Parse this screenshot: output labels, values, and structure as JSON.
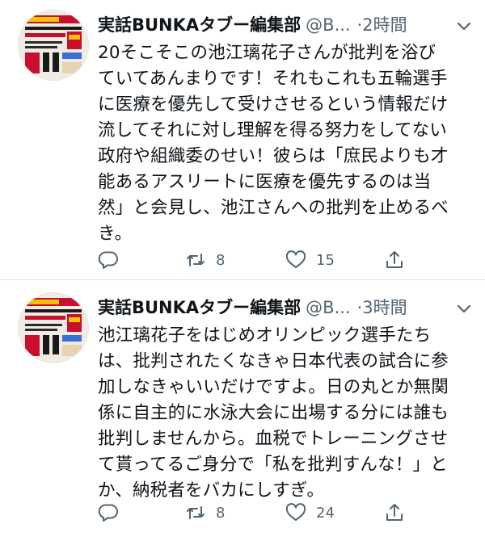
{
  "tweets": [
    {
      "author": "実話BUNKAタブー編集部",
      "handle": "@B...",
      "dot": "·",
      "time": "2時間",
      "lines": [
        "20そこそこの池江璃花子さんが批判を浴び",
        "ていてあんまりです！それもこれも五輪選手",
        "に医療を優先して受けさせるという情報だけ",
        "流してそれに対し理解を得る努力をしてない",
        "政府や組織委のせい！彼らは「庶民よりも才",
        "能あるアスリートに医療を優先するのは当",
        "然」と会見し、池江さんへの批判を止めるべ",
        "き。"
      ],
      "retweets": "8",
      "likes": "15"
    },
    {
      "author": "実話BUNKAタブー編集部",
      "handle": "@B...",
      "dot": "·",
      "time": "3時間",
      "lines": [
        "池江璃花子をはじめオリンピック選手たち",
        "は、批判されたくなきゃ日本代表の試合に参",
        "加しなきゃいいだけですよ。日の丸とか無関",
        "係に自主的に水泳大会に出場する分には誰も",
        "批判しませんから。血税でトレーニングさせ",
        "て貰ってるご身分で「私を批判すんな！」と",
        "か、納税者をバカにしすぎ。"
      ],
      "retweets": "8",
      "likes": "24"
    }
  ],
  "icons": {
    "reply": "reply-icon",
    "retweet": "retweet-icon",
    "like": "heart-icon",
    "share": "share-icon",
    "more": "chevron-down-icon"
  },
  "colors": {
    "text": "#0f1419",
    "secondary": "#536471",
    "divider": "#dfe3e6",
    "avatar_red": "#c8102e",
    "avatar_yellow": "#f2c300"
  }
}
